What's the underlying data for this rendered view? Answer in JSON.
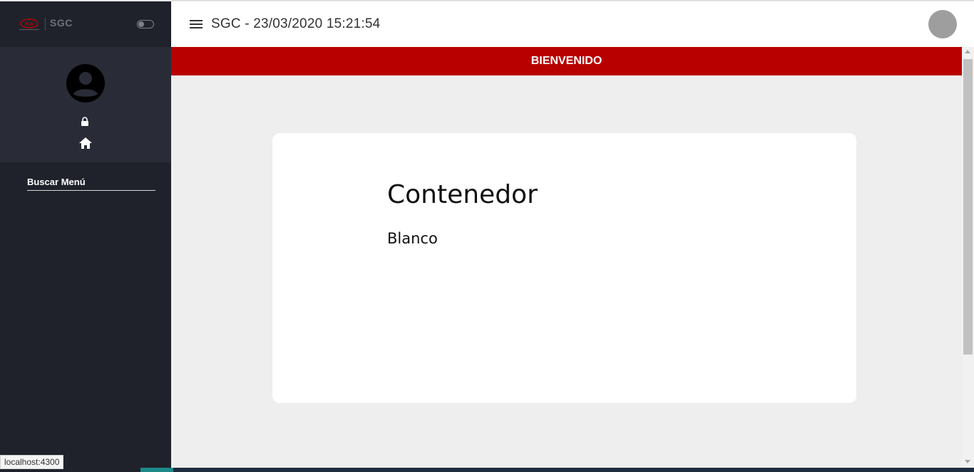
{
  "sidebar": {
    "brand": "SGC",
    "search_placeholder": "Buscar Menú"
  },
  "header": {
    "title": "SGC - 23/03/2020 15:21:54"
  },
  "banner": {
    "text": "BIENVENIDO"
  },
  "content": {
    "title": "Contenedor",
    "subtitle": "Blanco"
  },
  "status": {
    "url": "localhost:4300"
  },
  "colors": {
    "sidebar_bg": "#1f222b",
    "profile_bg": "#292c37",
    "banner_red": "#b80000",
    "page_bg": "#eeeeee"
  },
  "icons": [
    "kia-logo",
    "toggle-switch",
    "account-circle-icon",
    "lock-icon",
    "home-icon",
    "menu-icon",
    "user-avatar"
  ]
}
